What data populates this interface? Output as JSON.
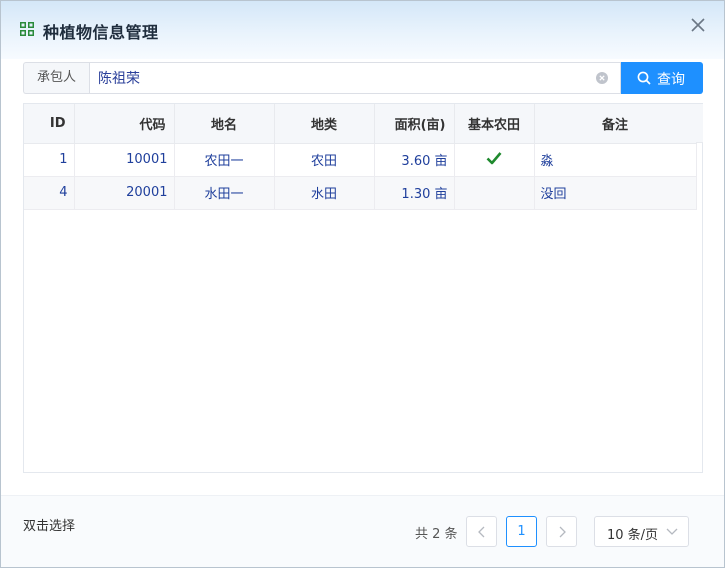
{
  "dialog": {
    "title": "种植物信息管理",
    "icon": "grid-icon",
    "close_icon": "close-icon"
  },
  "search": {
    "label": "承包人",
    "value": "陈祖荣",
    "button_label": "查询",
    "accent": "#1e90ff"
  },
  "table": {
    "columns": [
      "ID",
      "代码",
      "地名",
      "地类",
      "面积(亩)",
      "基本农田",
      "备注"
    ],
    "rows": [
      {
        "id": "1",
        "code": "10001",
        "place": "农田一",
        "type": "农田",
        "area": "3.60 亩",
        "basic": true,
        "note": "淼"
      },
      {
        "id": "4",
        "code": "20001",
        "place": "水田一",
        "type": "水田",
        "area": "1.30 亩",
        "basic": false,
        "note": "没回"
      }
    ]
  },
  "footer": {
    "hint": "双击选择",
    "total": "共 2 条",
    "current_page": "1",
    "page_size": "10 条/页"
  }
}
